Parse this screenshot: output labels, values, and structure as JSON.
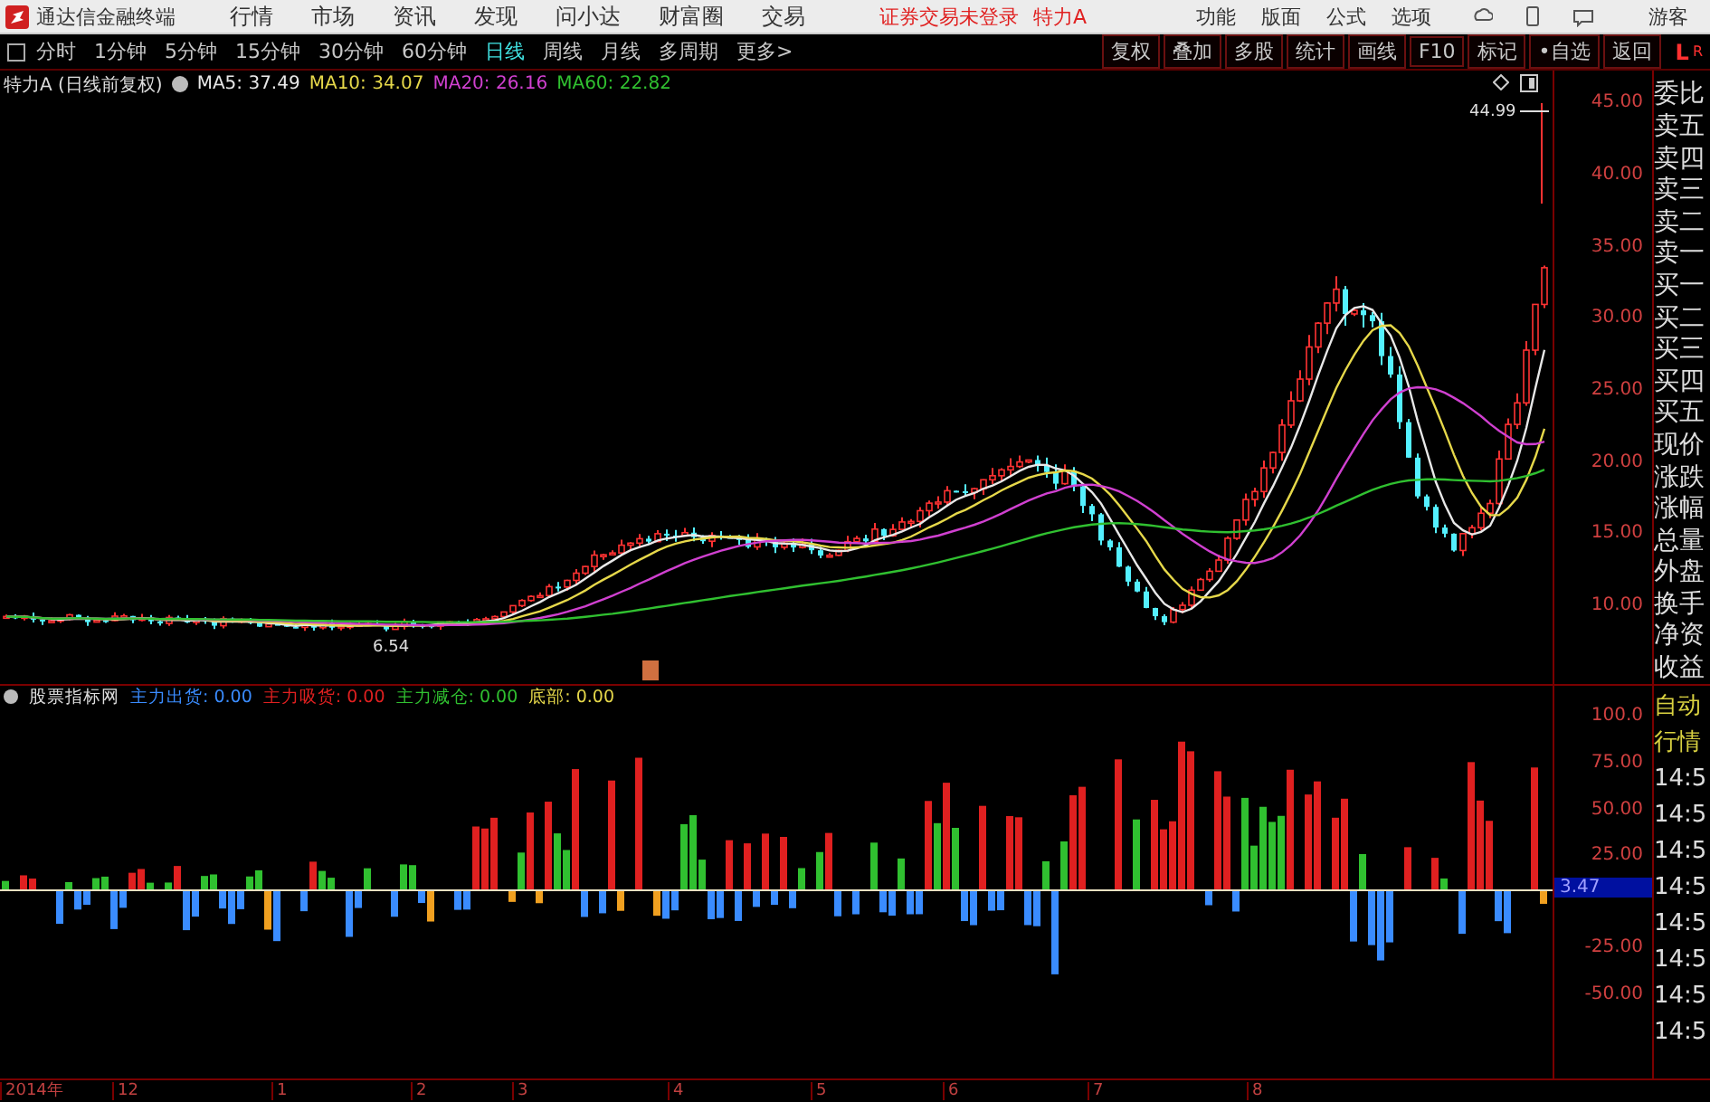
{
  "menubar": {
    "app_title": "通达信金融终端",
    "menus": [
      "行情",
      "市场",
      "资讯",
      "发现",
      "问小达",
      "财富圈",
      "交易"
    ],
    "login_notice": "证券交易未登录",
    "stock": "特力A",
    "tools": [
      "功能",
      "版面",
      "公式",
      "选项"
    ],
    "user": "游客"
  },
  "toolbar": {
    "periods": [
      {
        "label": "分时",
        "selected": false
      },
      {
        "label": "1分钟",
        "selected": false
      },
      {
        "label": "5分钟",
        "selected": false
      },
      {
        "label": "15分钟",
        "selected": false
      },
      {
        "label": "30分钟",
        "selected": false
      },
      {
        "label": "60分钟",
        "selected": false
      },
      {
        "label": "日线",
        "selected": true
      },
      {
        "label": "周线",
        "selected": false
      },
      {
        "label": "月线",
        "selected": false
      },
      {
        "label": "多周期",
        "selected": false
      },
      {
        "label": "更多>",
        "selected": false
      }
    ],
    "actions": [
      "复权",
      "叠加",
      "多股",
      "统计",
      "画线",
      "F10",
      "标记",
      "•自选",
      "返回"
    ],
    "side_tabs": [
      "L",
      "R"
    ]
  },
  "price_panel": {
    "title": "特力A (日线前复权)",
    "moving_averages": [
      {
        "label": "MA5: 37.49",
        "color": "#e8e8e8"
      },
      {
        "label": "MA10: 34.07",
        "color": "#e6d84a"
      },
      {
        "label": "MA20: 26.16",
        "color": "#d040d0"
      },
      {
        "label": "MA60: 22.82",
        "color": "#30c030"
      }
    ],
    "axis_labels": [
      "45.00",
      "40.00",
      "35.00",
      "30.00",
      "25.00",
      "20.00",
      "15.00",
      "10.00"
    ],
    "high_label": "44.99",
    "low_label": "6.54"
  },
  "quote_fields": [
    "委比",
    "卖五",
    "卖四",
    "卖三",
    "卖二",
    "卖一",
    "买一",
    "买二",
    "买三",
    "买四",
    "买五",
    "现价",
    "涨跌",
    "涨幅",
    "总量",
    "外盘",
    "换手",
    "净资",
    "收益"
  ],
  "indicator_panel": {
    "title": "股票指标网",
    "series": [
      {
        "label": "主力出货: 0.00",
        "color": "#3a8cff"
      },
      {
        "label": "主力吸货: 0.00",
        "color": "#e02020"
      },
      {
        "label": "主力减仓: 0.00",
        "color": "#30c030"
      },
      {
        "label": "底部: 0.00",
        "color": "#e6d84a"
      }
    ],
    "axis_labels": [
      "100.0",
      "75.00",
      "50.00",
      "25.00",
      "-25.00",
      "-50.00"
    ],
    "current_value": "3.47"
  },
  "side_list": {
    "tabs": [
      "自动",
      "行情"
    ],
    "times": [
      "14:5",
      "14:5",
      "14:5",
      "14:5",
      "14:5",
      "14:5",
      "14:5",
      "14:5"
    ]
  },
  "date_axis": [
    "2014年",
    "12",
    "1",
    "2",
    "3",
    "4",
    "5",
    "6",
    "7",
    "8"
  ]
}
